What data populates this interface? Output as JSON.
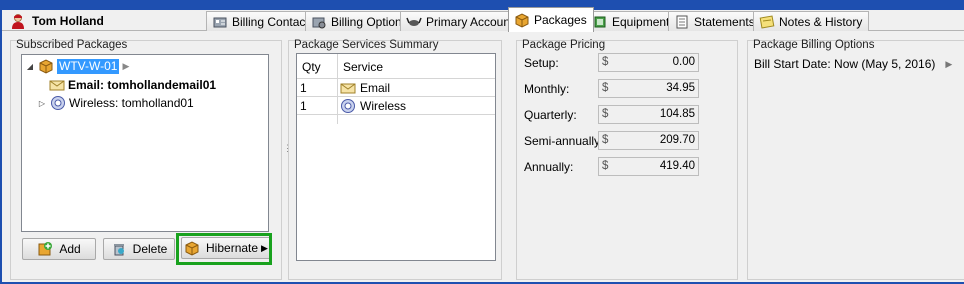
{
  "customer": {
    "name": "Tom Holland",
    "icon": "customer-person-icon"
  },
  "tabs": [
    {
      "label": "Billing Contact",
      "icon": "billing-contact-icon"
    },
    {
      "label": "Billing Options",
      "icon": "billing-options-icon"
    },
    {
      "label": "Primary Account",
      "icon": "primary-account-icon"
    },
    {
      "label": "Packages",
      "icon": "packages-icon",
      "active": true
    },
    {
      "label": "Equipment",
      "icon": "equipment-icon"
    },
    {
      "label": "Statements",
      "icon": "statements-icon"
    },
    {
      "label": "Notes & History",
      "icon": "notes-icon"
    }
  ],
  "subscribed": {
    "title": "Subscribed Packages",
    "tree": {
      "package": "WTV-W-01",
      "children": [
        {
          "label": "Email: tomhollandemail01",
          "icon": "email-icon"
        },
        {
          "label": "Wireless: tomholland01",
          "icon": "wireless-icon"
        }
      ]
    },
    "buttons": {
      "add": "Add",
      "delete": "Delete",
      "hibernate": "Hibernate"
    }
  },
  "services": {
    "title": "Package Services Summary",
    "columns": {
      "qty": "Qty",
      "service": "Service"
    },
    "rows": [
      {
        "qty": "1",
        "service": "Email",
        "icon": "email-icon"
      },
      {
        "qty": "1",
        "service": "Wireless",
        "icon": "wireless-icon"
      }
    ]
  },
  "pricing": {
    "title": "Package Pricing",
    "currency": "$",
    "rows": [
      {
        "label": "Setup:",
        "value": "0.00"
      },
      {
        "label": "Monthly:",
        "value": "34.95"
      },
      {
        "label": "Quarterly:",
        "value": "104.85"
      },
      {
        "label": "Semi-annually:",
        "value": "209.70"
      },
      {
        "label": "Annually:",
        "value": "419.40"
      }
    ]
  },
  "billing_options": {
    "title": "Package Billing Options",
    "bill_start": "Bill Start Date: Now (May 5, 2016)"
  },
  "colors": {
    "selection": "#3399ff",
    "highlight": "#19a21e",
    "window": "#1e4fb0"
  }
}
